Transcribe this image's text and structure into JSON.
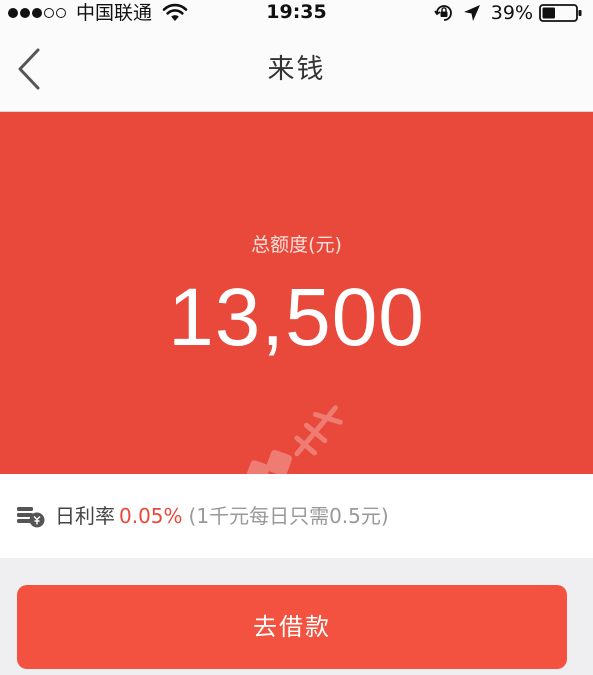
{
  "status_bar": {
    "carrier": "中国联通",
    "time": "19:35",
    "battery_percent": "39%",
    "signal_bars_filled": 3,
    "signal_bars_total": 5,
    "battery_level": 0.39
  },
  "nav": {
    "title": "来钱",
    "back_icon": "chevron-left-icon"
  },
  "credit": {
    "label": "总额度(元)",
    "amount": "13,500"
  },
  "rate": {
    "label": "日利率",
    "value": "0.05%",
    "note": "(1千元每日只需0.5元)",
    "icon": "coins-icon"
  },
  "actions": {
    "borrow_label": "去借款"
  },
  "colors": {
    "brand_red": "#e9493b",
    "button_red": "#f2523f"
  }
}
